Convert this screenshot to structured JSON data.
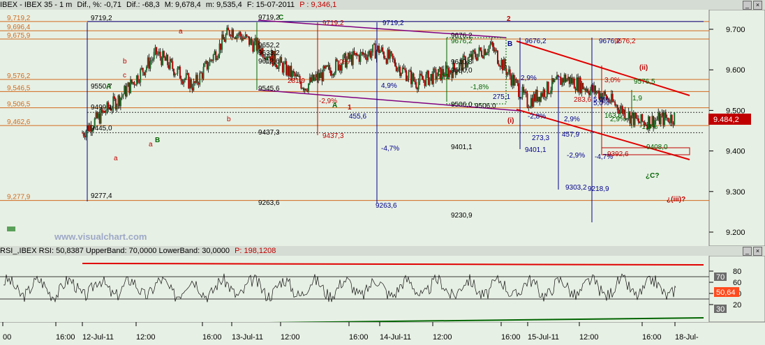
{
  "price_panel": {
    "title": {
      "symbol": "IBEX - IBEX 35 - 1 m",
      "dif_pct_label": "Dif., %: -0,71",
      "dif_label": "Dif.: -68,3",
      "max_label": "M: 9,678,4",
      "min_label": "m: 9,535,4",
      "date_label": "F: 15-07-2011",
      "price_label": "P : 9,346,1"
    },
    "y_ticks": [
      "9.700",
      "9.600",
      "9.500",
      "9.400",
      "9.300",
      "9.200"
    ],
    "current_price": "9.484,2",
    "watermark": "www.visualchart.com",
    "horizontal_levels": [
      {
        "label": "9,719,2",
        "value": 9719.2,
        "color": "#d2691e"
      },
      {
        "label": "9,696,4",
        "value": 9696.4,
        "color": "#d2691e"
      },
      {
        "label": "9,675,9",
        "value": 9675.9,
        "color": "#d2691e"
      },
      {
        "label": "9,576,2",
        "value": 9576.2,
        "color": "#d2691e"
      },
      {
        "label": "9,546,5",
        "value": 9546.5,
        "color": "#d2691e"
      },
      {
        "label": "9,506,5",
        "value": 9506.5,
        "color": "#d2691e"
      },
      {
        "label": "9,462,6",
        "value": 9462.6,
        "color": "#d2691e"
      },
      {
        "label": "9,277,9",
        "value": 9277.9,
        "color": "#d2691e"
      }
    ],
    "annotations": [
      {
        "text": "9719,2",
        "color": "#000000"
      },
      {
        "text": "9719,2",
        "color": "#000000"
      },
      {
        "text": "C",
        "color": "#006400"
      },
      {
        "text": "9550,7",
        "color": "#000000"
      },
      {
        "text": "A",
        "color": "#006400"
      },
      {
        "text": "9499,1",
        "color": "#000000"
      },
      {
        "text": "9445,0",
        "color": "#000000"
      },
      {
        "text": "9277,4",
        "color": "#000000"
      },
      {
        "text": "B",
        "color": "#006400"
      },
      {
        "text": "a",
        "color": "#c00000"
      },
      {
        "text": "b",
        "color": "#c00000"
      },
      {
        "text": "c",
        "color": "#c00000"
      },
      {
        "text": "a",
        "color": "#c00000"
      },
      {
        "text": "a",
        "color": "#c00000"
      },
      {
        "text": "b",
        "color": "#c00000"
      },
      {
        "text": "9652,2",
        "color": "#000000"
      },
      {
        "text": "9633,2",
        "color": "#000000"
      },
      {
        "text": "9612,6",
        "color": "#000000"
      },
      {
        "text": "9545,6",
        "color": "#000000"
      },
      {
        "text": "281,9",
        "color": "#c00000"
      },
      {
        "text": "-2,9%",
        "color": "#c00000"
      },
      {
        "text": "0%",
        "color": "#c00000"
      },
      {
        "text": "A",
        "color": "#006400"
      },
      {
        "text": "1",
        "color": "#c00000"
      },
      {
        "text": "9437,3",
        "color": "#000000"
      },
      {
        "text": "9437,3",
        "color": "#c00000"
      },
      {
        "text": "9263,6",
        "color": "#000000"
      },
      {
        "text": "9719,2",
        "color": "#c00000"
      },
      {
        "text": "9719,2",
        "color": "#00008b"
      },
      {
        "text": "4,9%",
        "color": "#00008b"
      },
      {
        "text": "455,6",
        "color": "#00008b"
      },
      {
        "text": "-4,7%",
        "color": "#00008b"
      },
      {
        "text": "9263,6",
        "color": "#00008b"
      },
      {
        "text": "2",
        "color": "#c00000"
      },
      {
        "text": "9676,2",
        "color": "#000000"
      },
      {
        "text": "9676,2",
        "color": "#006400"
      },
      {
        "text": "B",
        "color": "#00008b"
      },
      {
        "text": "9676,2",
        "color": "#00008b"
      },
      {
        "text": "9610,8",
        "color": "#000000"
      },
      {
        "text": "9580,0",
        "color": "#000000"
      },
      {
        "text": "171",
        "color": "#006400"
      },
      {
        "text": "-1,8%",
        "color": "#006400"
      },
      {
        "text": "2,9%",
        "color": "#00008b"
      },
      {
        "text": "275,1",
        "color": "#00008b"
      },
      {
        "text": "9506,0",
        "color": "#000000"
      },
      {
        "text": "9506,0",
        "color": "#000000"
      },
      {
        "text": "-2,8%",
        "color": "#00008b"
      },
      {
        "text": "(i)",
        "color": "#c00000"
      },
      {
        "text": "273,3",
        "color": "#00008b"
      },
      {
        "text": "9401,1",
        "color": "#000000"
      },
      {
        "text": "9401,1",
        "color": "#00008b"
      },
      {
        "text": "9230,9",
        "color": "#000000"
      },
      {
        "text": "9676,2",
        "color": "#00008b"
      },
      {
        "text": "9676,2",
        "color": "#c00000"
      },
      {
        "text": "2,9%",
        "color": "#00008b"
      },
      {
        "text": "457,9",
        "color": "#00008b"
      },
      {
        "text": "-2,9%",
        "color": "#00008b"
      },
      {
        "text": "9303,2",
        "color": "#00008b"
      },
      {
        "text": "5,0%",
        "color": "#00008b"
      },
      {
        "text": "-4,7%",
        "color": "#00008b"
      },
      {
        "text": "9218,9",
        "color": "#00008b"
      },
      {
        "text": "283,6",
        "color": "#c00000"
      },
      {
        "text": "3,0%",
        "color": "#c00000"
      },
      {
        "text": "9576,5",
        "color": "#006400"
      },
      {
        "text": "(ii)",
        "color": "#c00000"
      },
      {
        "text": "163,6",
        "color": "#006400"
      },
      {
        "text": "2,9%",
        "color": "#006400"
      },
      {
        "text": "1,9",
        "color": "#006400"
      },
      {
        "text": "-1,8%",
        "color": "#006400"
      },
      {
        "text": "9408,0",
        "color": "#006400"
      },
      {
        "text": "9392,6",
        "color": "#c00000"
      },
      {
        "text": "¿C?",
        "color": "#006400"
      },
      {
        "text": "¿(iii)?",
        "color": "#c00000"
      },
      {
        "text": "5,0%",
        "color": "#00008b"
      }
    ]
  },
  "rsi_panel": {
    "title": "RSI_,IBEX RSI: 50,8387 UpperBand: 70,0000 LowerBand: 30,0000",
    "price_label": "P: 198,1208",
    "y_ticks": [
      "80",
      "60",
      "40",
      "20"
    ],
    "upper_badge": "70",
    "value_badge": "50,64",
    "lower_badge": "30"
  },
  "time_axis": {
    "labels": [
      "00",
      "16:00",
      "12-Jul-11",
      "12:00",
      "16:00",
      "13-Jul-11",
      "12:00",
      "16:00",
      "14-Jul-11",
      "12:00",
      "16:00",
      "15-Jul-11",
      "12:00",
      "16:00",
      "18-Jul-"
    ]
  },
  "chart_data": {
    "type": "line",
    "title": "IBEX - IBEX 35 - 1 m",
    "xlabel": "",
    "ylabel": "",
    "ylim": [
      9170,
      9760
    ],
    "x": [
      "12-Jul-11 10:00",
      "12-Jul-11 12:00",
      "12-Jul-11 14:00",
      "12-Jul-11 16:00",
      "13-Jul-11 10:00",
      "13-Jul-11 12:00",
      "13-Jul-11 14:00",
      "13-Jul-11 16:00",
      "14-Jul-11 10:00",
      "14-Jul-11 12:00",
      "14-Jul-11 14:00",
      "14-Jul-11 16:00",
      "15-Jul-11 10:00",
      "15-Jul-11 12:00",
      "15-Jul-11 14:00",
      "15-Jul-11 16:00",
      "15-Jul-11 17:30"
    ],
    "series": [
      {
        "values": [
          9445,
          9530,
          9640,
          9560,
          9700,
          9640,
          9560,
          9620,
          9650,
          9570,
          9600,
          9660,
          9520,
          9580,
          9540,
          9470,
          9484.2
        ]
      }
    ],
    "rsi": {
      "upper_band": 70,
      "lower_band": 30,
      "last_value": 50.64,
      "ylim": [
        0,
        100
      ]
    }
  }
}
